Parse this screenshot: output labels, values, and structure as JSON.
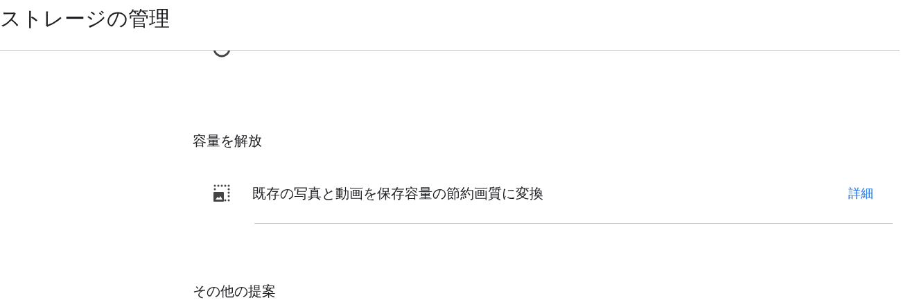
{
  "header": {
    "title": "ストレージの管理"
  },
  "sections": [
    {
      "heading": "容量を解放",
      "items": [
        {
          "label": "既存の写真と動画を保存容量の節約画質に変換",
          "link": "詳細"
        }
      ]
    },
    {
      "heading": "その他の提案"
    }
  ]
}
